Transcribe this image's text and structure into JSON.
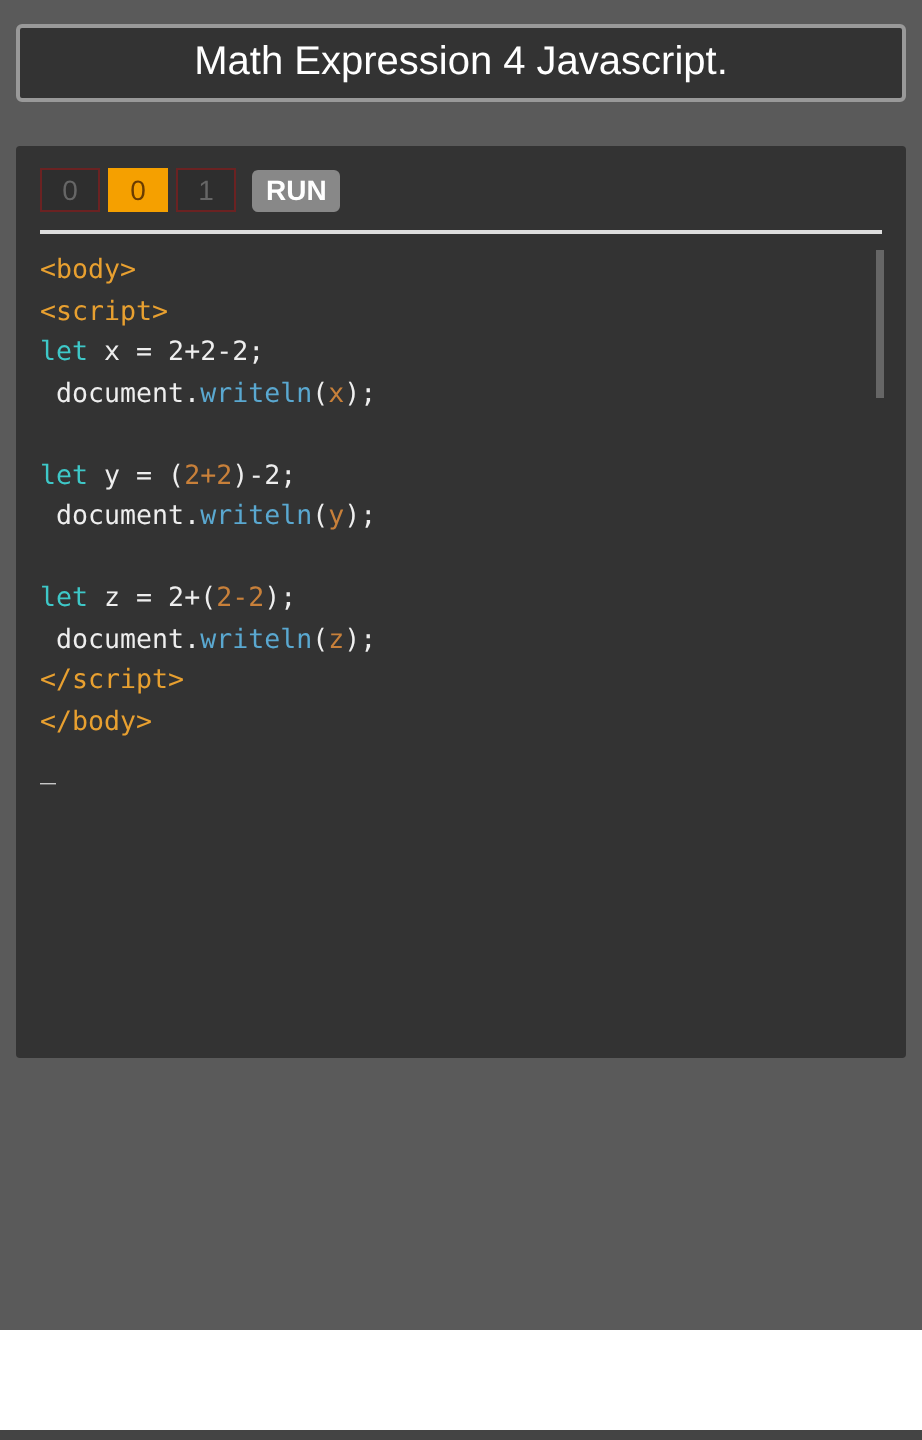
{
  "title": "Math Expression 4 Javascript.",
  "toggles": [
    {
      "label": "0",
      "selected": false
    },
    {
      "label": "0",
      "selected": true
    },
    {
      "label": "1",
      "selected": false
    }
  ],
  "run_button": "RUN",
  "code_lines": [
    [
      {
        "kind": "tag",
        "text": "<body>"
      }
    ],
    [
      {
        "kind": "tag",
        "text": "<script>"
      }
    ],
    [
      {
        "kind": "keyword",
        "text": "let"
      },
      {
        "kind": "plain",
        "text": " x = 2+2-2;"
      }
    ],
    [
      {
        "kind": "plain",
        "text": " document."
      },
      {
        "kind": "method",
        "text": "writeln"
      },
      {
        "kind": "plain",
        "text": "("
      },
      {
        "kind": "number",
        "text": "x"
      },
      {
        "kind": "plain",
        "text": ");"
      }
    ],
    [
      {
        "kind": "gap"
      },
      {
        "kind": "keyword",
        "text": "let"
      },
      {
        "kind": "plain",
        "text": " y = ("
      },
      {
        "kind": "number",
        "text": "2+2"
      },
      {
        "kind": "plain",
        "text": ")-2;"
      }
    ],
    [
      {
        "kind": "plain",
        "text": " document."
      },
      {
        "kind": "method",
        "text": "writeln"
      },
      {
        "kind": "plain",
        "text": "("
      },
      {
        "kind": "number",
        "text": "y"
      },
      {
        "kind": "plain",
        "text": ");"
      }
    ],
    [
      {
        "kind": "gap"
      },
      {
        "kind": "keyword",
        "text": "let"
      },
      {
        "kind": "plain",
        "text": " z = 2+("
      },
      {
        "kind": "number",
        "text": "2-2"
      },
      {
        "kind": "plain",
        "text": ");"
      }
    ],
    [
      {
        "kind": "plain",
        "text": " document."
      },
      {
        "kind": "method",
        "text": "writeln"
      },
      {
        "kind": "plain",
        "text": "("
      },
      {
        "kind": "number",
        "text": "z"
      },
      {
        "kind": "plain",
        "text": ");"
      }
    ],
    [
      {
        "kind": "tag",
        "text": "</script>"
      }
    ],
    [
      {
        "kind": "tag",
        "text": "</body>"
      }
    ]
  ],
  "cursor": "_"
}
